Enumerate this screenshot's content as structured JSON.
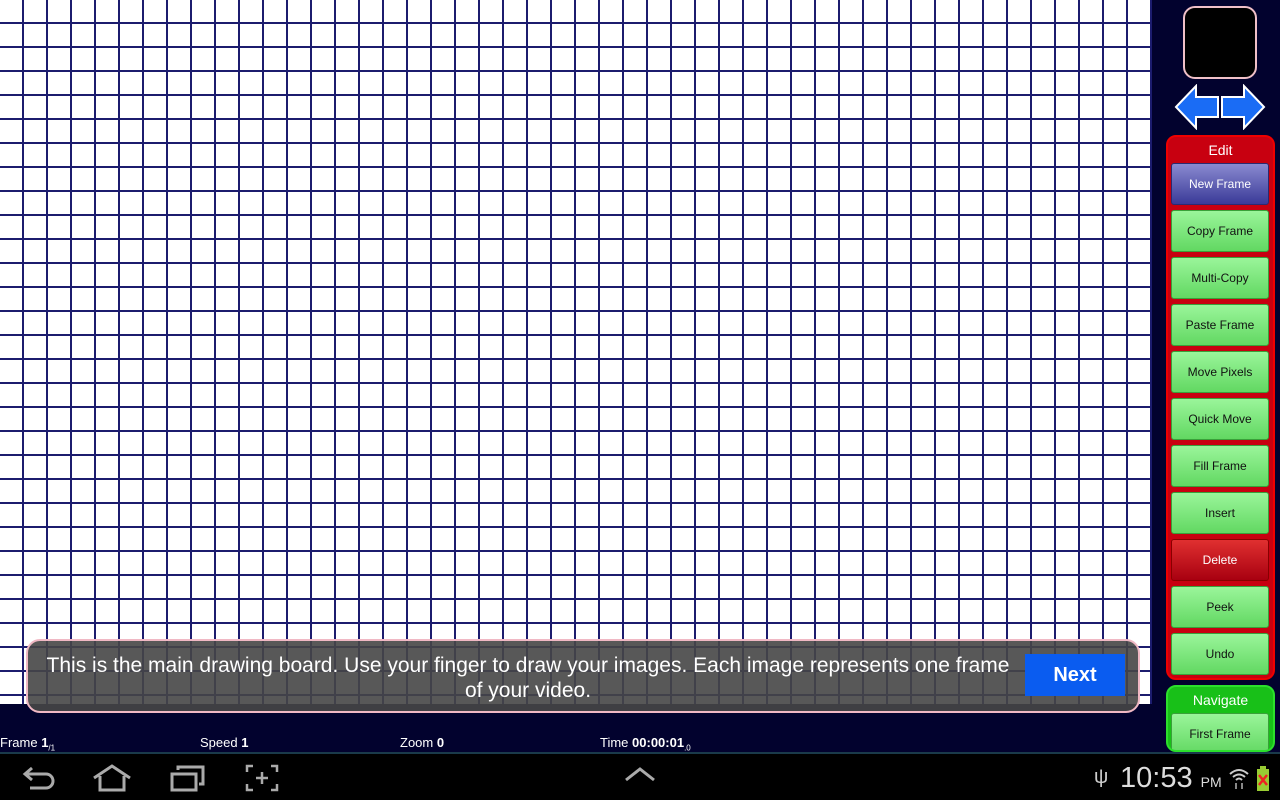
{
  "tooltip": {
    "text": "This is the main drawing board. Use your finger to draw your images. Each image represents one frame of your video.",
    "next_label": "Next"
  },
  "edit": {
    "title": "Edit",
    "buttons": [
      {
        "label": "New Frame",
        "style": "blue"
      },
      {
        "label": "Copy Frame",
        "style": "green"
      },
      {
        "label": "Multi-Copy",
        "style": "green"
      },
      {
        "label": "Paste Frame",
        "style": "green"
      },
      {
        "label": "Move Pixels",
        "style": "green"
      },
      {
        "label": "Quick Move",
        "style": "green"
      },
      {
        "label": "Fill Frame",
        "style": "green"
      },
      {
        "label": "Insert",
        "style": "green"
      },
      {
        "label": "Delete",
        "style": "red"
      },
      {
        "label": "Peek",
        "style": "green"
      },
      {
        "label": "Undo",
        "style": "green"
      }
    ]
  },
  "navigate": {
    "title": "Navigate",
    "buttons": [
      {
        "label": "First Frame"
      }
    ]
  },
  "status": {
    "frame_label": "Frame",
    "frame_value": "1",
    "frame_total": "/1",
    "speed_label": "Speed",
    "speed_value": "1",
    "zoom_label": "Zoom",
    "zoom_value": "0",
    "time_label": "Time",
    "time_value": "00:00:01",
    "time_fraction": ".0"
  },
  "system": {
    "time": "10:53",
    "ampm": "PM",
    "icons": [
      "back-icon",
      "home-icon",
      "recent-apps-icon",
      "screenshot-icon",
      "up-chevron-icon",
      "usb-icon",
      "wifi-icon",
      "battery-icon"
    ]
  },
  "colors": {
    "grid_line": "#1c1c6e",
    "edit_panel": "#c80010",
    "navigate_panel": "#18c018",
    "next_button": "#0a5cf0"
  }
}
